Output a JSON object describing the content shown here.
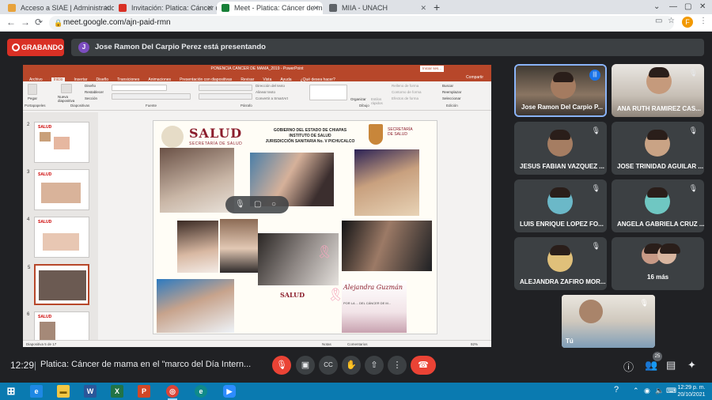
{
  "browser": {
    "tabs": [
      {
        "title": "Acceso a SIAE | Administrador | S",
        "favicon_color": "#e8a33c"
      },
      {
        "title": "Invitación: Platica: Cáncer de ma",
        "favicon_color": "#d93025"
      },
      {
        "title": "Meet - Platica: Cáncer de ma",
        "favicon_color": "#188038"
      },
      {
        "title": "MIIA - UNACH",
        "favicon_color": "#5f6368"
      }
    ],
    "new_tab": "+",
    "url": "meet.google.com/ajn-paid-rmn",
    "profile_initial": "F"
  },
  "meet": {
    "recording_label": "GRABANDO",
    "presenter_initial": "J",
    "presenter_banner": "Jose Ramon Del Carpio Perez está presentando",
    "meeting_time": "12:29",
    "meeting_separator": "|",
    "meeting_title": "Platica: Cáncer de mama en el \"marco del Día Intern...",
    "participant_count": "25",
    "participants": [
      {
        "name": "Jose Ramon Del Carpio P...",
        "speaking": true,
        "video": true
      },
      {
        "name": "ANA RUTH RAMIREZ CAS...",
        "video": true
      },
      {
        "name": "JESUS FABIAN VAZQUEZ ..."
      },
      {
        "name": "JOSE TRINIDAD AGUILAR ..."
      },
      {
        "name": "LUIS ENRIQUE LOPEZ FO..."
      },
      {
        "name": "ANGELA GABRIELA CRUZ ..."
      },
      {
        "name": "ALEJANDRA ZAFIRO MOR..."
      },
      {
        "name": "16 más"
      }
    ],
    "self_label": "Tú"
  },
  "powerpoint": {
    "window_title": "PONENCIA CANCER DE MAMA_2019  -  PowerPoint",
    "signin": "Iniciar ses...",
    "menu": [
      "Archivo",
      "Inicio",
      "Insertar",
      "Diseño",
      "Transiciones",
      "Animaciones",
      "Presentación con diapositivas",
      "Revisar",
      "Vista",
      "Ayuda",
      "¿Qué desea hacer?"
    ],
    "share": "Compartir",
    "ribbon_groups": [
      "Portapapeles",
      "Diapositivas",
      "Fuente",
      "Párrafo",
      "Dibujo",
      "Edición"
    ],
    "ribbon_labels": [
      "Pegar",
      "Nueva diapositiva",
      "Diseño",
      "Restablecer",
      "Sección",
      "Dirección del texto",
      "Alinear texto",
      "Convertir a SmartArt",
      "Organizar",
      "Estilos rápidos",
      "Relleno de forma",
      "Contorno de forma",
      "Efectos de forma",
      "Buscar",
      "Reemplazar",
      "Seleccionar"
    ],
    "thumb_numbers": [
      "2",
      "3",
      "4",
      "5",
      "6"
    ],
    "status": "Diapositiva 5 de 17",
    "notes": "Notas",
    "comments": "Comentarios",
    "zoom": "92%",
    "slide": {
      "salud": "SALUD",
      "salud_sub": "SECRETARÍA DE SALUD",
      "gob_line1": "GOBIERNO DEL ESTADO DE CHIAPAS",
      "gob_line2": "INSTITUTO DE SALUD",
      "gob_line3": "JURISDICCIÓN SANITARIA No. V PICHUCALCO",
      "sec_line1": "SECRETARÍA",
      "sec_line2": "DE SALUD",
      "salud_small": "SALUD",
      "script": "Alejandra Guzmán",
      "caption": "POR LA ... DEL CÁNCER DE M..."
    }
  },
  "windows": {
    "clock_time": "12:29 p. m.",
    "clock_date": "20/10/2021",
    "apps": [
      {
        "name": "start",
        "glyph": "⊞",
        "color": "#0a7ab0"
      },
      {
        "name": "edge-legacy",
        "glyph": "e",
        "color": "#1e88e5"
      },
      {
        "name": "file-explorer",
        "glyph": "▬",
        "color": "#f2c744"
      },
      {
        "name": "word",
        "glyph": "W",
        "color": "#2b579a"
      },
      {
        "name": "excel",
        "glyph": "X",
        "color": "#217346"
      },
      {
        "name": "powerpoint",
        "glyph": "P",
        "color": "#d24726"
      },
      {
        "name": "chrome",
        "glyph": "◎",
        "color": "#db4437"
      },
      {
        "name": "edge",
        "glyph": "e",
        "color": "#0f8a8a"
      },
      {
        "name": "zoom",
        "glyph": "▶",
        "color": "#2d8cff"
      }
    ]
  }
}
